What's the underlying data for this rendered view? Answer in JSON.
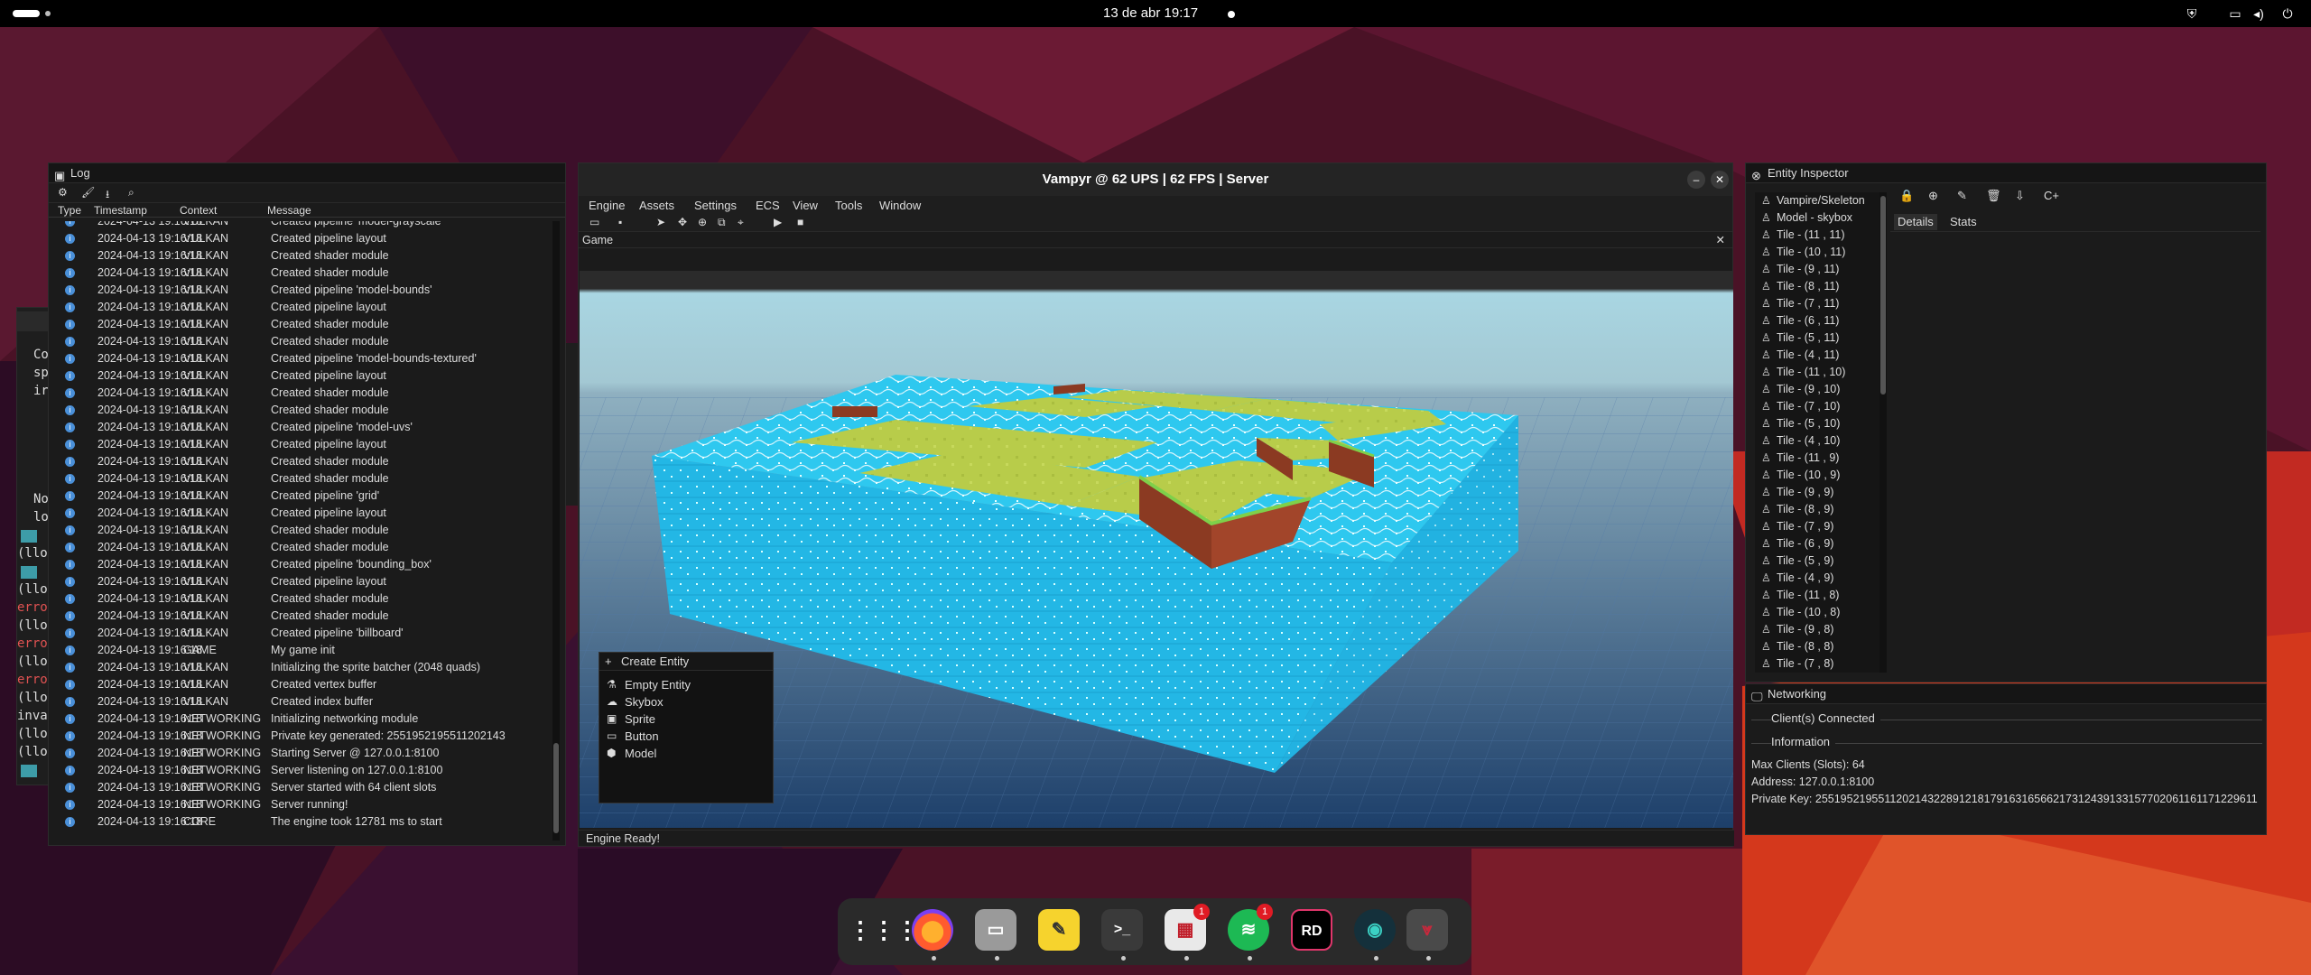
{
  "topbar": {
    "clock": "13 de abr  19:17"
  },
  "log_panel": {
    "title": "Log",
    "columns": [
      "Type",
      "Timestamp",
      "Context",
      "Message"
    ],
    "rows": [
      {
        "ts": "2024-04-13 19:16:18",
        "ctx": "VULKAN",
        "msg": "Created pipeline 'model-grayscale'"
      },
      {
        "ts": "2024-04-13 19:16:18",
        "ctx": "VULKAN",
        "msg": "Created pipeline layout"
      },
      {
        "ts": "2024-04-13 19:16:18",
        "ctx": "VULKAN",
        "msg": "Created shader module"
      },
      {
        "ts": "2024-04-13 19:16:18",
        "ctx": "VULKAN",
        "msg": "Created shader module"
      },
      {
        "ts": "2024-04-13 19:16:18",
        "ctx": "VULKAN",
        "msg": "Created pipeline 'model-bounds'"
      },
      {
        "ts": "2024-04-13 19:16:18",
        "ctx": "VULKAN",
        "msg": "Created pipeline layout"
      },
      {
        "ts": "2024-04-13 19:16:18",
        "ctx": "VULKAN",
        "msg": "Created shader module"
      },
      {
        "ts": "2024-04-13 19:16:18",
        "ctx": "VULKAN",
        "msg": "Created shader module"
      },
      {
        "ts": "2024-04-13 19:16:18",
        "ctx": "VULKAN",
        "msg": "Created pipeline 'model-bounds-textured'"
      },
      {
        "ts": "2024-04-13 19:16:18",
        "ctx": "VULKAN",
        "msg": "Created pipeline layout"
      },
      {
        "ts": "2024-04-13 19:16:18",
        "ctx": "VULKAN",
        "msg": "Created shader module"
      },
      {
        "ts": "2024-04-13 19:16:18",
        "ctx": "VULKAN",
        "msg": "Created shader module"
      },
      {
        "ts": "2024-04-13 19:16:18",
        "ctx": "VULKAN",
        "msg": "Created pipeline 'model-uvs'"
      },
      {
        "ts": "2024-04-13 19:16:18",
        "ctx": "VULKAN",
        "msg": "Created pipeline layout"
      },
      {
        "ts": "2024-04-13 19:16:18",
        "ctx": "VULKAN",
        "msg": "Created shader module"
      },
      {
        "ts": "2024-04-13 19:16:18",
        "ctx": "VULKAN",
        "msg": "Created shader module"
      },
      {
        "ts": "2024-04-13 19:16:18",
        "ctx": "VULKAN",
        "msg": "Created pipeline 'grid'"
      },
      {
        "ts": "2024-04-13 19:16:18",
        "ctx": "VULKAN",
        "msg": "Created pipeline layout"
      },
      {
        "ts": "2024-04-13 19:16:18",
        "ctx": "VULKAN",
        "msg": "Created shader module"
      },
      {
        "ts": "2024-04-13 19:16:18",
        "ctx": "VULKAN",
        "msg": "Created shader module"
      },
      {
        "ts": "2024-04-13 19:16:18",
        "ctx": "VULKAN",
        "msg": "Created pipeline 'bounding_box'"
      },
      {
        "ts": "2024-04-13 19:16:18",
        "ctx": "VULKAN",
        "msg": "Created pipeline layout"
      },
      {
        "ts": "2024-04-13 19:16:18",
        "ctx": "VULKAN",
        "msg": "Created shader module"
      },
      {
        "ts": "2024-04-13 19:16:18",
        "ctx": "VULKAN",
        "msg": "Created shader module"
      },
      {
        "ts": "2024-04-13 19:16:18",
        "ctx": "VULKAN",
        "msg": "Created pipeline 'billboard'"
      },
      {
        "ts": "2024-04-13 19:16:18",
        "ctx": "GAME",
        "msg": "My game init"
      },
      {
        "ts": "2024-04-13 19:16:18",
        "ctx": "VULKAN",
        "msg": "Initializing the sprite batcher (2048 quads)"
      },
      {
        "ts": "2024-04-13 19:16:18",
        "ctx": "VULKAN",
        "msg": "Created vertex buffer"
      },
      {
        "ts": "2024-04-13 19:16:18",
        "ctx": "VULKAN",
        "msg": "Created index buffer"
      },
      {
        "ts": "2024-04-13 19:16:18",
        "ctx": "NETWORKING",
        "msg": "Initializing networking module"
      },
      {
        "ts": "2024-04-13 19:16:18",
        "ctx": "NETWORKING",
        "msg": "Private key generated: 2551952195511202143"
      },
      {
        "ts": "2024-04-13 19:16:18",
        "ctx": "NETWORKING",
        "msg": "Starting Server @ 127.0.0.1:8100"
      },
      {
        "ts": "2024-04-13 19:16:18",
        "ctx": "NETWORKING",
        "msg": "Server listening on 127.0.0.1:8100"
      },
      {
        "ts": "2024-04-13 19:16:18",
        "ctx": "NETWORKING",
        "msg": "Server started with 64 client slots"
      },
      {
        "ts": "2024-04-13 19:16:18",
        "ctx": "NETWORKING",
        "msg": "Server running!"
      },
      {
        "ts": "2024-04-13 19:16:18",
        "ctx": "CORE",
        "msg": "The engine took 12781 ms to start"
      }
    ]
  },
  "terminal_fragments": {
    "lines": [
      "Co",
      "sp",
      "ir",
      "No",
      "lo",
      "(llo",
      "(llo",
      "erro",
      "(llo",
      "erro",
      "(llo",
      "erro",
      "(llo",
      "inva",
      "(llo",
      "(llo"
    ]
  },
  "main_window": {
    "title": "Vampyr @ 62 UPS | 62 FPS | Server",
    "menu": [
      "Engine",
      "Assets",
      "Settings",
      "ECS",
      "View",
      "Tools",
      "Window"
    ],
    "game_tab": "Game",
    "status": "Engine Ready!"
  },
  "create_entity": {
    "header": "Create Entity",
    "items": [
      {
        "label": "Empty Entity",
        "icon": "flask-icon"
      },
      {
        "label": "Skybox",
        "icon": "cloud-icon"
      },
      {
        "label": "Sprite",
        "icon": "image-icon"
      },
      {
        "label": "Button",
        "icon": "button-icon"
      },
      {
        "label": "Model",
        "icon": "cube-icon"
      }
    ]
  },
  "inspector": {
    "title": "Entity Inspector",
    "entities": [
      "Vampire/Skeleton",
      "Model - skybox",
      "Tile - (11 , 11)",
      "Tile - (10 , 11)",
      "Tile - (9 , 11)",
      "Tile - (8 , 11)",
      "Tile - (7 , 11)",
      "Tile - (6 , 11)",
      "Tile - (5 , 11)",
      "Tile - (4 , 11)",
      "Tile - (11 , 10)",
      "Tile - (9 , 10)",
      "Tile - (7 , 10)",
      "Tile - (5 , 10)",
      "Tile - (4 , 10)",
      "Tile - (11 , 9)",
      "Tile - (10 , 9)",
      "Tile - (9 , 9)",
      "Tile - (8 , 9)",
      "Tile - (7 , 9)",
      "Tile - (6 , 9)",
      "Tile - (5 , 9)",
      "Tile - (4 , 9)",
      "Tile - (11 , 8)",
      "Tile - (10 , 8)",
      "Tile - (9 , 8)",
      "Tile - (8 , 8)",
      "Tile - (7 , 8)"
    ],
    "tabs": [
      "Details",
      "Stats"
    ]
  },
  "networking": {
    "title": "Networking",
    "clients_section": "Client(s) Connected",
    "info_section": "Information",
    "max_clients": "Max Clients (Slots): 64",
    "address": "Address: 127.0.0.1:8100",
    "private_key": "Private Key: 25519521955112021432289121817916316566217312439133157702061161171229611"
  },
  "dock": {
    "apps": [
      "apps-grid-icon",
      "firefox-icon",
      "files-icon",
      "text-editor-icon",
      "terminal-icon",
      "software-icon",
      "spotify-icon",
      "rider-icon",
      "gitkraken-icon",
      "vampyr-icon"
    ],
    "badges": {
      "software": "1",
      "spotify": "1"
    }
  },
  "colors": {
    "accent": "#4a90d9",
    "water": "#2ec8ef",
    "grass": "#b8cc4a",
    "dirt": "#8b3a22"
  }
}
